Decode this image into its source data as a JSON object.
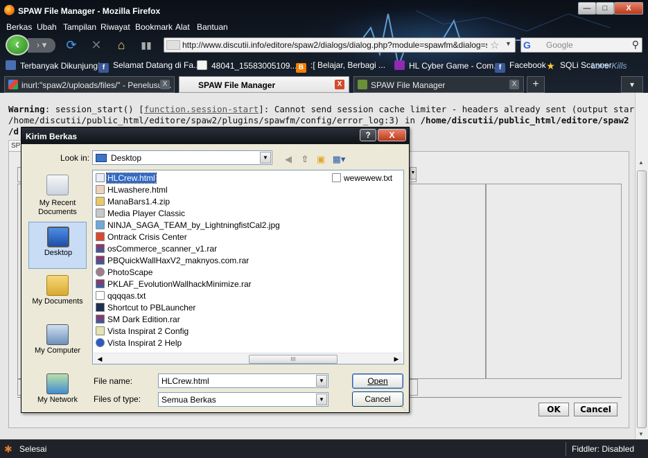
{
  "window": {
    "title": "SPAW File Manager - Mozilla Firefox"
  },
  "menu": [
    "Berkas",
    "Ubah",
    "Tampilan",
    "Riwayat",
    "Bookmark",
    "Alat",
    "Bantuan"
  ],
  "nav": {
    "url": "http://www.discutii.info/editore/spaw2/dialogs/dialog.php?module=spawfm&dialog=spawfr",
    "search_placeholder": "Google"
  },
  "bookmarks": [
    {
      "label": "Terbanyak Dikunjungi",
      "icon": "bookmark-folder-icon"
    },
    {
      "label": "Selamat Datang di Fa...",
      "icon": "facebook-icon"
    },
    {
      "label": "48041_15583005109...",
      "icon": "page-icon"
    },
    {
      "label": ":[ Belajar, Berbagi ...",
      "icon": "blogger-icon"
    },
    {
      "label": "HL Cyber Game - Com...",
      "icon": "site-icon"
    },
    {
      "label": "Facebook",
      "icon": "facebook-icon"
    },
    {
      "label": "SQLi Scanner",
      "icon": "star-icon"
    }
  ],
  "bookmarks_overlay_text": "Love Kills",
  "tabs": [
    {
      "label": "inurl:\"spaw2/uploads/files/\" - Penelusur...",
      "active": false
    },
    {
      "label": "SPAW File Manager",
      "active": true
    },
    {
      "label": "SPAW File Manager",
      "active": false
    }
  ],
  "page": {
    "warning_label": "Warning",
    "warning_line1a": ": session_start() [",
    "warning_link": "function.session-start",
    "warning_line1b": "]: Cannot send session cache limiter - headers already sent (output started at",
    "warning_line2a": "/home/discutii/public_html/editore/spaw2/plugins/spawfm/config/error_log:3) in ",
    "warning_line2b": "/home/discutii/public_html/editore/spaw2",
    "warning_line3": "/d",
    "ok_label": "OK",
    "cancel_label": "Cancel",
    "tab_fragment": "SP"
  },
  "status": {
    "text": "Selesai",
    "fiddler": "Fiddler: Disabled"
  },
  "dialog": {
    "title": "Kirim Berkas",
    "help": "?",
    "close": "X",
    "look_in_label": "Look in:",
    "look_in_value": "Desktop",
    "places": [
      {
        "label": "My Recent Documents",
        "icon": "recent-documents-icon",
        "selected": false
      },
      {
        "label": "Desktop",
        "icon": "desktop-icon",
        "selected": true
      },
      {
        "label": "My Documents",
        "icon": "my-documents-icon",
        "selected": false
      },
      {
        "label": "My Computer",
        "icon": "my-computer-icon",
        "selected": false
      },
      {
        "label": "My Network",
        "icon": "my-network-icon",
        "selected": false
      }
    ],
    "files": [
      {
        "name": "HLCrew.html",
        "icon": "html-file-icon",
        "selected": true
      },
      {
        "name": "HLwashere.html",
        "icon": "html-file-icon"
      },
      {
        "name": "ManaBars1.4.zip",
        "icon": "zip-file-icon"
      },
      {
        "name": "Media Player Classic",
        "icon": "media-player-icon"
      },
      {
        "name": "NINJA_SAGA_TEAM_by_LightningfistCal2.jpg",
        "icon": "image-file-icon"
      },
      {
        "name": "Ontrack Crisis Center",
        "icon": "app-shortcut-icon"
      },
      {
        "name": "osCommerce_scanner_v1.rar",
        "icon": "rar-file-icon"
      },
      {
        "name": "PBQuickWallHaxV2_maknyos.com.rar",
        "icon": "rar-file-icon"
      },
      {
        "name": "PhotoScape",
        "icon": "photoscape-icon"
      },
      {
        "name": "PKLAF_EvolutionWallhackMinimize.rar",
        "icon": "rar-file-icon"
      },
      {
        "name": "qqqqas.txt",
        "icon": "text-file-icon"
      },
      {
        "name": "Shortcut to PBLauncher",
        "icon": "app-shortcut-icon"
      },
      {
        "name": "SM Dark Edition.rar",
        "icon": "rar-file-icon"
      },
      {
        "name": "Vista Inspirat 2 Config",
        "icon": "config-icon"
      },
      {
        "name": "Vista Inspirat 2 Help",
        "icon": "help-icon"
      },
      {
        "name": "wewewew.txt",
        "icon": "text-file-icon"
      }
    ],
    "file_name_label": "File name:",
    "file_name_value": "HLCrew.html",
    "files_of_type_label": "Files of type:",
    "files_of_type_value": "Semua Berkas",
    "open_label": "Open",
    "cancel_label": "Cancel",
    "scroll_grip": "III"
  }
}
